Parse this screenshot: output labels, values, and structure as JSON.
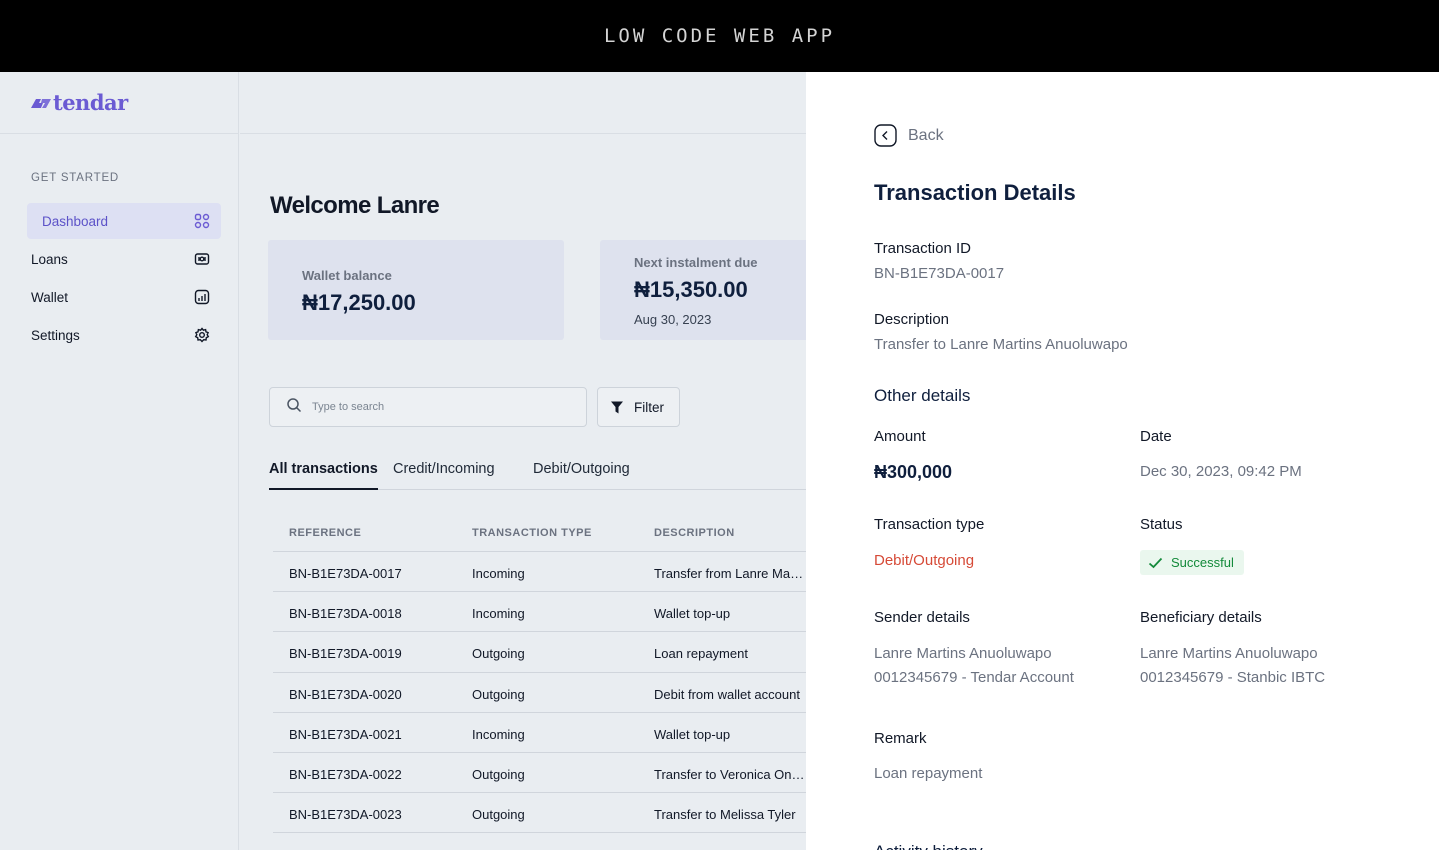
{
  "banner": {
    "title": "LOW CODE WEB APP"
  },
  "brand": {
    "name": "tendar",
    "color": "#6b5bd3"
  },
  "sidebar": {
    "section_label": "GET STARTED",
    "items": [
      {
        "label": "Dashboard",
        "icon": "grid-icon",
        "active": true
      },
      {
        "label": "Loans",
        "icon": "loan-icon",
        "active": false
      },
      {
        "label": "Wallet",
        "icon": "chart-box-icon",
        "active": false
      },
      {
        "label": "Settings",
        "icon": "gear-icon",
        "active": false
      }
    ]
  },
  "main": {
    "welcome": "Welcome Lanre",
    "cards": [
      {
        "label": "Wallet balance",
        "value": "₦17,250.00"
      },
      {
        "label": "Next instalment due",
        "value": "₦15,350.00",
        "sub": "Aug 30, 2023"
      }
    ],
    "search": {
      "placeholder": "Type to search"
    },
    "filter_label": "Filter",
    "tabs": [
      {
        "label": "All transactions",
        "active": true
      },
      {
        "label": "Credit/Incoming",
        "active": false
      },
      {
        "label": "Debit/Outgoing",
        "active": false
      }
    ],
    "table": {
      "headers": [
        "REFERENCE",
        "TRANSACTION TYPE",
        "DESCRIPTION"
      ],
      "rows": [
        [
          "BN-B1E73DA-0017",
          "Incoming",
          "Transfer from Lanre Martins Anuoluwapo"
        ],
        [
          "BN-B1E73DA-0018",
          "Incoming",
          "Wallet top-up"
        ],
        [
          "BN-B1E73DA-0019",
          "Outgoing",
          "Loan repayment"
        ],
        [
          "BN-B1E73DA-0020",
          "Outgoing",
          "Debit from wallet account"
        ],
        [
          "BN-B1E73DA-0021",
          "Incoming",
          "Wallet top-up"
        ],
        [
          "BN-B1E73DA-0022",
          "Outgoing",
          "Transfer to Veronica Onyekachi"
        ],
        [
          "BN-B1E73DA-0023",
          "Outgoing",
          "Transfer to Melissa Tyler"
        ]
      ]
    }
  },
  "panel": {
    "back_label": "Back",
    "title": "Transaction Details",
    "transaction_id_label": "Transaction ID",
    "transaction_id": "BN-B1E73DA-0017",
    "description_label": "Description",
    "description": "Transfer to Lanre Martins Anuoluwapo",
    "other_details_title": "Other details",
    "amount_label": "Amount",
    "amount": "₦300,000",
    "date_label": "Date",
    "date": "Dec 30, 2023, 09:42 PM",
    "transaction_type_label": "Transaction type",
    "transaction_type": "Debit/Outgoing",
    "transaction_type_color": "#d64a37",
    "status_label": "Status",
    "status": "Successful",
    "status_color": "#138a3a",
    "sender_label": "Sender details",
    "sender_name": "Lanre Martins Anuoluwapo",
    "sender_account": "0012345679 - Tendar Account",
    "beneficiary_label": "Beneficiary details",
    "beneficiary_name": "Lanre Martins Anuoluwapo",
    "beneficiary_account": "0012345679 - Stanbic IBTC",
    "remark_label": "Remark",
    "remark": "Loan repayment",
    "activity_title": "Activity history"
  }
}
